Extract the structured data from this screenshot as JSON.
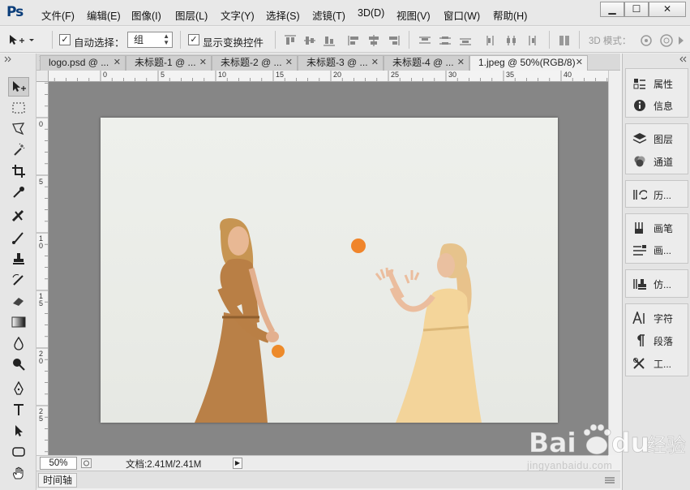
{
  "app": {
    "logo": "Ps"
  },
  "menu": [
    "文件(F)",
    "编辑(E)",
    "图像(I)",
    "图层(L)",
    "文字(Y)",
    "选择(S)",
    "滤镜(T)",
    "3D(D)",
    "视图(V)",
    "窗口(W)",
    "帮助(H)"
  ],
  "window_controls": {
    "minimize": "▁",
    "restore": "☐",
    "close": "✕"
  },
  "options": {
    "auto_select_label": "自动选择：",
    "auto_select_checked": true,
    "select_value": "组",
    "show_transform_label": "显示变换控件",
    "show_transform_checked": true,
    "mode_3d_label": "3D 模式："
  },
  "tabs": [
    {
      "label": "logo.psd @ ...",
      "active": false
    },
    {
      "label": "未标题-1 @ ...",
      "active": false
    },
    {
      "label": "未标题-2 @ ...",
      "active": false
    },
    {
      "label": "未标题-3 @ ...",
      "active": false
    },
    {
      "label": "未标题-4 @ ...",
      "active": false
    },
    {
      "label": "1.jpeg @ 50%(RGB/8)",
      "active": true
    }
  ],
  "ruler": {
    "top": [
      "0",
      "5",
      "10",
      "15",
      "20",
      "25",
      "30",
      "35",
      "40"
    ],
    "left": [
      "0",
      "5",
      "1 0",
      "1 5",
      "2 0",
      "2 5"
    ]
  },
  "status": {
    "zoom": "50%",
    "doc_info": "文档:2.41M/2.41M"
  },
  "timeline_label": "时间轴",
  "panels": [
    {
      "items": [
        {
          "label": "属性",
          "icon": "properties-icon"
        },
        {
          "label": "信息",
          "icon": "info-icon"
        }
      ]
    },
    {
      "items": [
        {
          "label": "图层",
          "icon": "layers-icon"
        },
        {
          "label": "通道",
          "icon": "channels-icon"
        }
      ]
    },
    {
      "items": [
        {
          "label": "历...",
          "icon": "history-icon"
        }
      ]
    },
    {
      "items": [
        {
          "label": "画笔",
          "icon": "brush-panel-icon"
        },
        {
          "label": "画...",
          "icon": "brush-presets-icon"
        }
      ]
    },
    {
      "items": [
        {
          "label": "仿...",
          "icon": "clone-source-icon"
        }
      ]
    },
    {
      "items": [
        {
          "label": "字符",
          "icon": "character-icon"
        },
        {
          "label": "段落",
          "icon": "paragraph-icon"
        },
        {
          "label": "工...",
          "icon": "tool-presets-icon"
        }
      ]
    }
  ],
  "watermark": {
    "text": "jingyanbaidu.com",
    "logo": "Bai du 经验"
  },
  "colors": {
    "canvas_bg": "#868686",
    "logo": "#0a3d7a",
    "ball": "#f0852b"
  }
}
